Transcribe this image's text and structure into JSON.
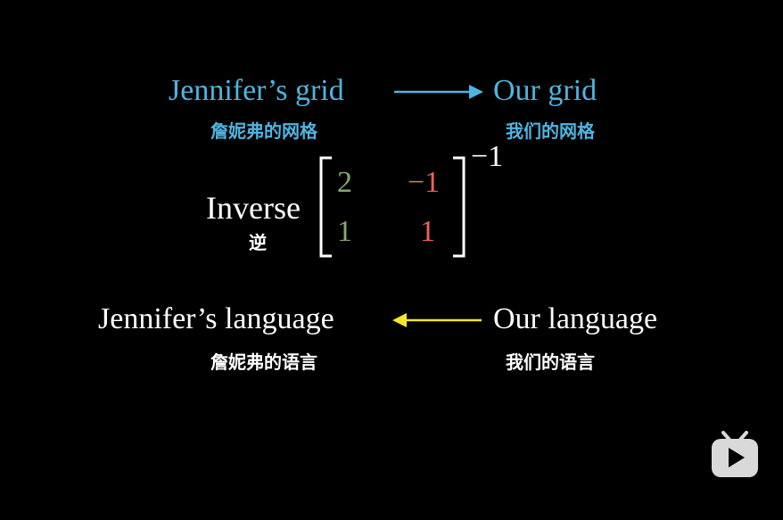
{
  "colors": {
    "background": "#000000",
    "blue": "#4fb4e0",
    "white": "#ffffff",
    "green": "#86a86e",
    "red": "#f0645a",
    "yellow": "#f5e62a",
    "logo": "#d9d9d9"
  },
  "top": {
    "left_title": "Jennifer’s grid",
    "left_subtitle": "詹妮弗的网格",
    "right_title": "Our grid",
    "right_subtitle": "我们的网格"
  },
  "matrix": {
    "label": "Inverse",
    "label_sub": "逆",
    "exponent": "−1",
    "cells": [
      [
        "2",
        "−1"
      ],
      [
        "1",
        "1"
      ]
    ]
  },
  "bottom": {
    "left_title": "Jennifer’s language",
    "left_subtitle": "詹妮弗的语言",
    "right_title": "Our language",
    "right_subtitle": "我们的语言"
  },
  "icons": {
    "top_arrow": "arrow-right-icon",
    "bottom_arrow": "arrow-left-icon",
    "logo": "tv-play-logo-icon"
  }
}
